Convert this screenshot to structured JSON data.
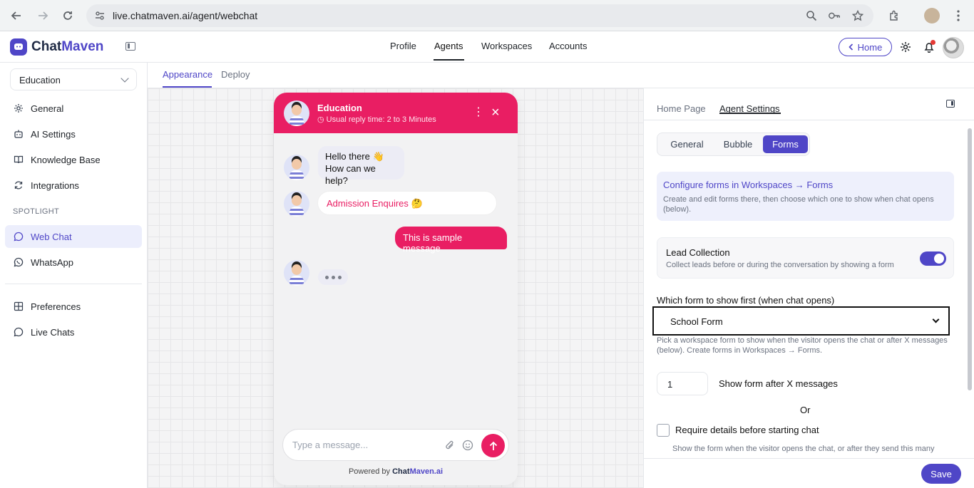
{
  "browser": {
    "url": "live.chatmaven.ai/agent/webchat"
  },
  "app": {
    "brand_prefix": "Chat",
    "brand_suffix": "Maven",
    "nav": [
      "Profile",
      "Agents",
      "Workspaces",
      "Accounts"
    ],
    "active_nav": "Agents",
    "home_label": "Home"
  },
  "sidebar": {
    "workspace": "Education",
    "items": [
      {
        "label": "General",
        "icon": "gear-icon"
      },
      {
        "label": "AI Settings",
        "icon": "robot-icon"
      },
      {
        "label": "Knowledge Base",
        "icon": "book-icon"
      },
      {
        "label": "Integrations",
        "icon": "refresh-icon"
      }
    ],
    "section_label": "SPOTLIGHT",
    "spotlight": [
      {
        "label": "Web Chat",
        "icon": "chat-bubble-icon",
        "active": true
      },
      {
        "label": "WhatsApp",
        "icon": "whatsapp-icon"
      }
    ],
    "bottom": [
      {
        "label": "Preferences",
        "icon": "grid-icon"
      },
      {
        "label": "Live Chats",
        "icon": "chat-bubble-icon"
      }
    ]
  },
  "subtabs": [
    "Appearance",
    "Deploy"
  ],
  "chat": {
    "title": "Education",
    "subtitle": "Usual reply time: 2 to 3 Minutes",
    "greeting_line1": "Hello there 👋",
    "greeting_line2": "How can we help?",
    "quick_reply": "Admission Enquires 🤔",
    "user_message": "This is sample message",
    "input_placeholder": "Type a message...",
    "powered_prefix": "Powered by ",
    "powered_brand_a": "Chat",
    "powered_brand_b": "Maven.ai",
    "header_color": "#e91e63"
  },
  "panel": {
    "tabs": [
      "Home Page",
      "Agent Settings"
    ],
    "active_tab": "Agent Settings",
    "segments": [
      "General",
      "Bubble",
      "Forms"
    ],
    "active_segment": "Forms",
    "info_link": "Configure forms in Workspaces → Forms",
    "info_text": "Create and edit forms there, then choose which one to show when chat opens (below).",
    "lead_title": "Lead Collection",
    "lead_sub": "Collect leads before or during the conversation by showing a form",
    "lead_enabled": true,
    "form_label": "Which form to show first (when chat opens)",
    "form_value": "School Form",
    "form_help": "Pick a workspace form to show when the visitor opens the chat or after X messages (below). Create forms in Workspaces → Forms.",
    "after_messages_value": "1",
    "after_messages_label": "Show form after X messages",
    "or_label": "Or",
    "require_label": "Require details before starting chat",
    "require_checked": false,
    "require_help": "Show the form when the visitor opens the chat, or after they send this many",
    "save_label": "Save",
    "accent": "#4f46c7"
  }
}
